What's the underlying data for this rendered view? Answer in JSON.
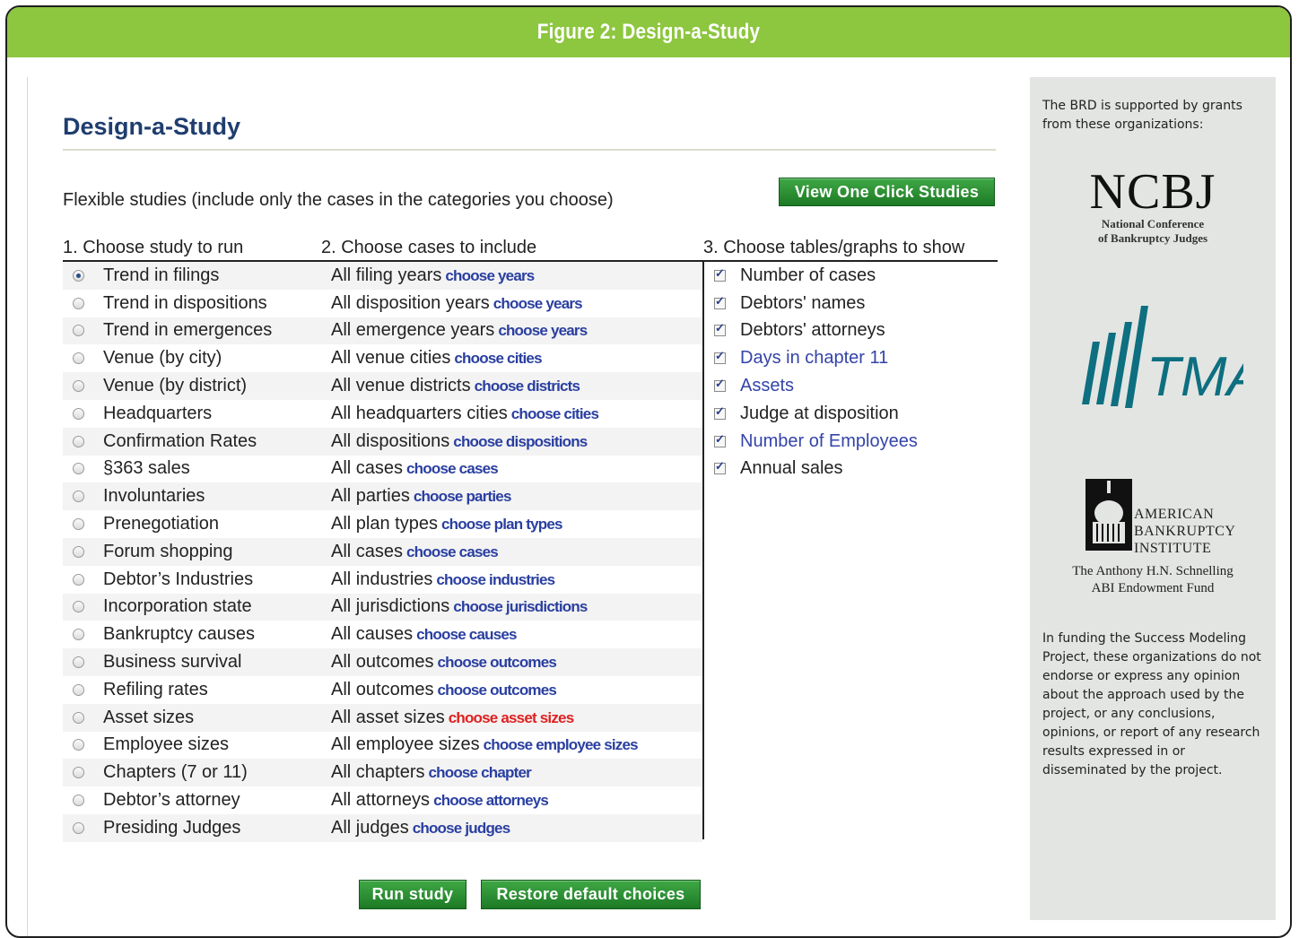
{
  "figure": {
    "title": "Figure 2: Design-a-Study"
  },
  "page": {
    "title": "Design-a-Study",
    "intro": "Flexible studies (include only the cases in the categories you choose)",
    "view_one_click_label": "View One Click Studies"
  },
  "columns": {
    "study": "1. Choose study to run",
    "cases": "2. Choose cases to include",
    "tables": "3. Choose tables/graphs to show"
  },
  "rows": [
    {
      "study": "Trend in filings",
      "cases": "All filing years",
      "choose": "choose years",
      "selected": true
    },
    {
      "study": "Trend in dispositions",
      "cases": "All disposition years",
      "choose": "choose years"
    },
    {
      "study": "Trend in emergences",
      "cases": "All emergence years",
      "choose": "choose years"
    },
    {
      "study": "Venue (by city)",
      "cases": "All venue cities",
      "choose": "choose cities"
    },
    {
      "study": "Venue (by district)",
      "cases": "All venue districts",
      "choose": "choose districts"
    },
    {
      "study": "Headquarters",
      "cases": "All headquarters cities",
      "choose": "choose cities"
    },
    {
      "study": "Confirmation Rates",
      "cases": "All dispositions",
      "choose": "choose dispositions"
    },
    {
      "study": "§363 sales",
      "cases": "All cases",
      "choose": "choose cases"
    },
    {
      "study": "Involuntaries",
      "cases": "All parties",
      "choose": "choose parties"
    },
    {
      "study": "Prenegotiation",
      "cases": "All plan types",
      "choose": "choose plan types"
    },
    {
      "study": "Forum shopping",
      "cases": "All cases",
      "choose": "choose cases"
    },
    {
      "study": "Debtor’s Industries",
      "cases": "All industries",
      "choose": "choose industries"
    },
    {
      "study": "Incorporation state",
      "cases": "All jurisdictions",
      "choose": "choose jurisdictions"
    },
    {
      "study": "Bankruptcy causes",
      "cases": "All causes",
      "choose": "choose causes"
    },
    {
      "study": "Business survival",
      "cases": "All outcomes",
      "choose": "choose outcomes"
    },
    {
      "study": "Refiling rates",
      "cases": "All outcomes",
      "choose": "choose outcomes"
    },
    {
      "study": "Asset sizes",
      "cases": "All asset sizes",
      "choose": "choose asset sizes",
      "highlight": true
    },
    {
      "study": "Employee sizes",
      "cases": "All employee sizes",
      "choose": "choose employee sizes"
    },
    {
      "study": "Chapters (7 or 11)",
      "cases": "All chapters",
      "choose": "choose chapter"
    },
    {
      "study": "Debtor’s attorney",
      "cases": "All attorneys",
      "choose": "choose attorneys"
    },
    {
      "study": "Presiding Judges",
      "cases": "All judges",
      "choose": "choose judges"
    }
  ],
  "tables": [
    {
      "label": "Number of cases",
      "checked": true,
      "link": false
    },
    {
      "label": "Debtors' names",
      "checked": true,
      "link": false
    },
    {
      "label": "Debtors' attorneys",
      "checked": true,
      "link": false
    },
    {
      "label": "Days in chapter 11",
      "checked": true,
      "link": true
    },
    {
      "label": "Assets",
      "checked": true,
      "link": true
    },
    {
      "label": "Judge at disposition",
      "checked": true,
      "link": false
    },
    {
      "label": "Number of Employees",
      "checked": true,
      "link": true
    },
    {
      "label": "Annual sales",
      "checked": true,
      "link": false
    }
  ],
  "buttons": {
    "run": "Run study",
    "restore": "Restore default choices"
  },
  "sidebar": {
    "intro": "The BRD is supported by grants from these organizations:",
    "ncbj_big": "NCBJ",
    "ncbj_line1": "National Conference",
    "ncbj_line2": "of Bankruptcy Judges",
    "tma": "TMA",
    "abi_line1": "AMERICAN",
    "abi_line2": "BANKRUPTCY",
    "abi_line3": "INSTITUTE",
    "abi_sub1": "The Anthony H.N. Schnelling",
    "abi_sub2": "ABI Endowment Fund",
    "disclaimer": "In funding the Success Modeling Project, these organizations do not endorse or express any opinion about the approach used by the project, or any conclusions, opinions, or report of any research results expressed in or disseminated by the project."
  },
  "colors": {
    "header_green": "#8dc63f",
    "title_blue": "#1f3d6e",
    "link_blue": "#2a3fa0",
    "highlight_red": "#e02020",
    "button_green": "#1d7a25",
    "sidebar_gray": "#e3e5e2"
  }
}
